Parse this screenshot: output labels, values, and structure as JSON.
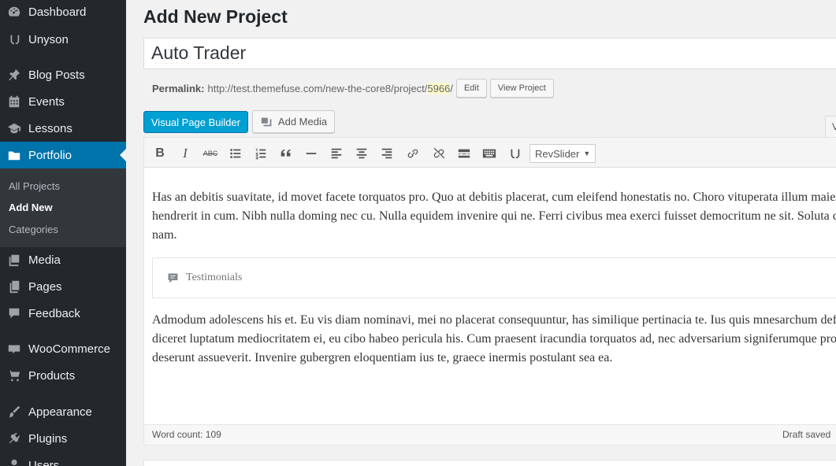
{
  "sidebar": {
    "items": [
      {
        "label": "Dashboard",
        "icon": "dashboard-icon"
      },
      {
        "label": "Unyson",
        "icon": "unyson-icon"
      },
      {
        "label": "Blog Posts",
        "icon": "pin-icon"
      },
      {
        "label": "Events",
        "icon": "calendar-icon"
      },
      {
        "label": "Lessons",
        "icon": "mortarboard-icon"
      },
      {
        "label": "Portfolio",
        "icon": "folder-icon",
        "active": true
      },
      {
        "label": "Media",
        "icon": "media-icon"
      },
      {
        "label": "Pages",
        "icon": "pages-icon"
      },
      {
        "label": "Feedback",
        "icon": "comment-icon"
      },
      {
        "label": "WooCommerce",
        "icon": "woo-icon"
      },
      {
        "label": "Products",
        "icon": "cart-icon"
      },
      {
        "label": "Appearance",
        "icon": "brush-icon"
      },
      {
        "label": "Plugins",
        "icon": "plugin-icon"
      },
      {
        "label": "Users",
        "icon": "users-icon"
      }
    ],
    "submenu": [
      "All Projects",
      "Add New",
      "Categories"
    ]
  },
  "page": {
    "title": "Add New Project",
    "post_title": "Auto Trader",
    "permalink_label": "Permalink:",
    "permalink_base": "http://test.themefuse.com/new-the-core8/project/",
    "permalink_slug": "5966",
    "permalink_tail": "/",
    "edit_label": "Edit",
    "view_label": "View Project",
    "visual_builder_label": "Visual Page Builder",
    "add_media_label": "Add Media",
    "tab_stub": "V"
  },
  "editor": {
    "revslider_label": "RevSlider",
    "paragraph1": "Has an debitis suavitate, id movet facete torquatos pro. Quo at debitis placerat, cum eleifend honestatis no. Choro vituperata illum maiestatis ad cum, adhuc hendrerit in cum. Nibh nulla doming nec cu. Nulla equidem invenire qui ne. Ferri civibus mea exerci fuisset democritum ne sit. Soluta conclusionemque ut nam.",
    "testimonials_label": "Testimonials",
    "paragraph2": "Admodum adolescens his et. Eu vis diam nominavi, mei no placerat consequuntur, has similique pertinacia te. Ius quis mnesarchum definitionem ex. Pro diceret luptatum mediocritatem ei, eu cibo habeo pericula his. Cum praesent iracundia torquatos ad, nec adversarium signiferumque pro, eum te voluptua deserunt assueverit. Invenire gubergren eloquentiam ius te, graece inermis postulant sea ea.",
    "word_count": "Word count: 109",
    "draft_status": "Draft saved"
  }
}
